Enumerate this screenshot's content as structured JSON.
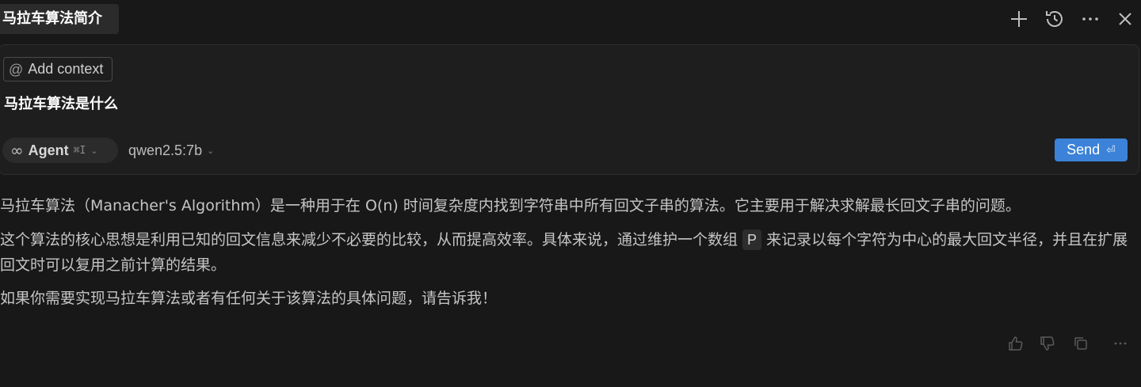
{
  "chat": {
    "title": "马拉车算法简介"
  },
  "top_actions": {
    "icons": [
      "plus-icon",
      "history-icon",
      "more-icon",
      "close-icon"
    ]
  },
  "composer": {
    "add_context_label": "Add context",
    "add_context_icon": "at-icon",
    "user_message": "马拉车算法是什么",
    "mode": {
      "label": "Agent",
      "shortcut": "⌘I",
      "icon": "infinity-icon"
    },
    "model": "qwen2.5:7b",
    "send_label": "Send",
    "send_icon": "enter-icon",
    "accent_color": "#3b82d8"
  },
  "response": {
    "p1": "马拉车算法（Manacher's Algorithm）是一种用于在 O(n) 时间复杂度内找到字符串中所有回文子串的算法。它主要用于解决求解最长回文子串的问题。",
    "p2_before": "这个算法的核心思想是利用已知的回文信息来减少不必要的比较，从而提高效率。具体来说，通过维护一个数组 ",
    "p2_code": "P",
    "p2_after": " 来记录以每个字符为中心的最大回文半径，并且在扩展回文时可以复用之前计算的结果。",
    "p3": "如果你需要实现马拉车算法或者有任何关于该算法的具体问题，请告诉我！"
  },
  "feedback": {
    "icons": [
      "thumbs-up-icon",
      "thumbs-down-icon",
      "copy-icon",
      "more-icon"
    ]
  }
}
